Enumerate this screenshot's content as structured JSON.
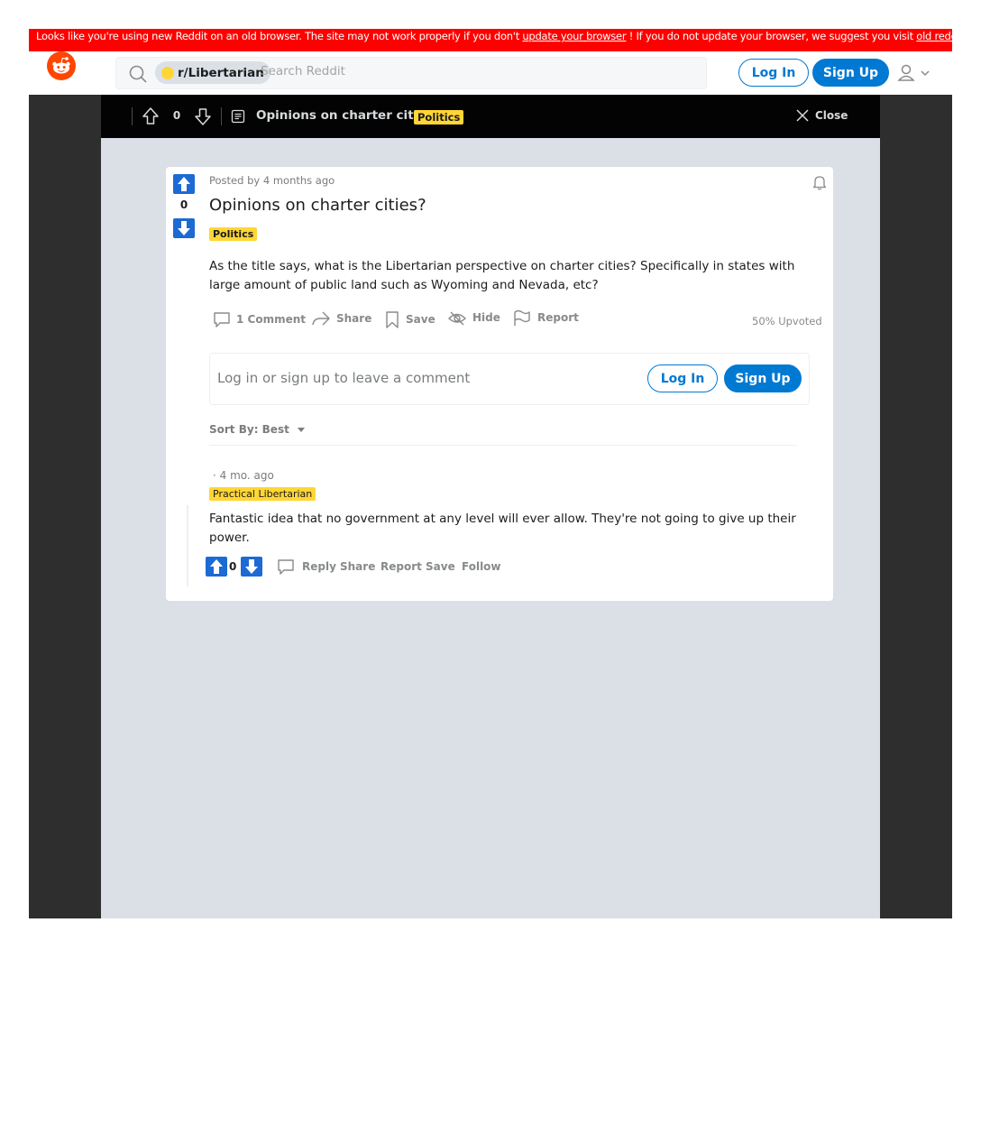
{
  "banner": {
    "text_before": "Looks like you're using new Reddit on an old browser. The site may not work properly if you don't ",
    "link1": "update your browser",
    "text_middle": " ! If you do not update your browser, we suggest you visit ",
    "link2": "old reddit"
  },
  "header": {
    "subreddit": "r/Libertarian",
    "search_placeholder": "Search Reddit",
    "login_label": "Log In",
    "signup_label": "Sign Up"
  },
  "topbar": {
    "score": "0",
    "title": "Opinions on charter cities?",
    "flair": "Politics",
    "close_label": "Close"
  },
  "post": {
    "score": "0",
    "posted_by": "Posted by",
    "time": "4 months ago",
    "title": "Opinions on charter cities?",
    "flair": "Politics",
    "body": "As the title says, what is the Libertarian perspective on charter cities? Specifically in states with large amount of public land such as Wyoming and Nevada, etc?",
    "actions": {
      "comments": "1 Comment",
      "share": "Share",
      "save": "Save",
      "hide": "Hide",
      "report": "Report"
    },
    "upvoted": "50% Upvoted"
  },
  "comment_box": {
    "prompt": "Log in or sign up to leave a comment",
    "login_label": "Log In",
    "signup_label": "Sign Up"
  },
  "sort": {
    "label": "Sort By: Best"
  },
  "comment": {
    "meta": "· 4 mo. ago",
    "flair": "Practical Libertarian",
    "body": "Fantastic idea that no government at any level will ever allow. They're not going to give up their power.",
    "score": "0",
    "actions": {
      "reply": "Reply",
      "share": "Share",
      "report": "Report",
      "save": "Save",
      "follow": "Follow"
    }
  },
  "colors": {
    "banner": "#ff0000",
    "brand": "#ff4500",
    "accent": "#0079d3",
    "flair": "#ffd635",
    "vote_arrow": "#1c6ad4"
  }
}
